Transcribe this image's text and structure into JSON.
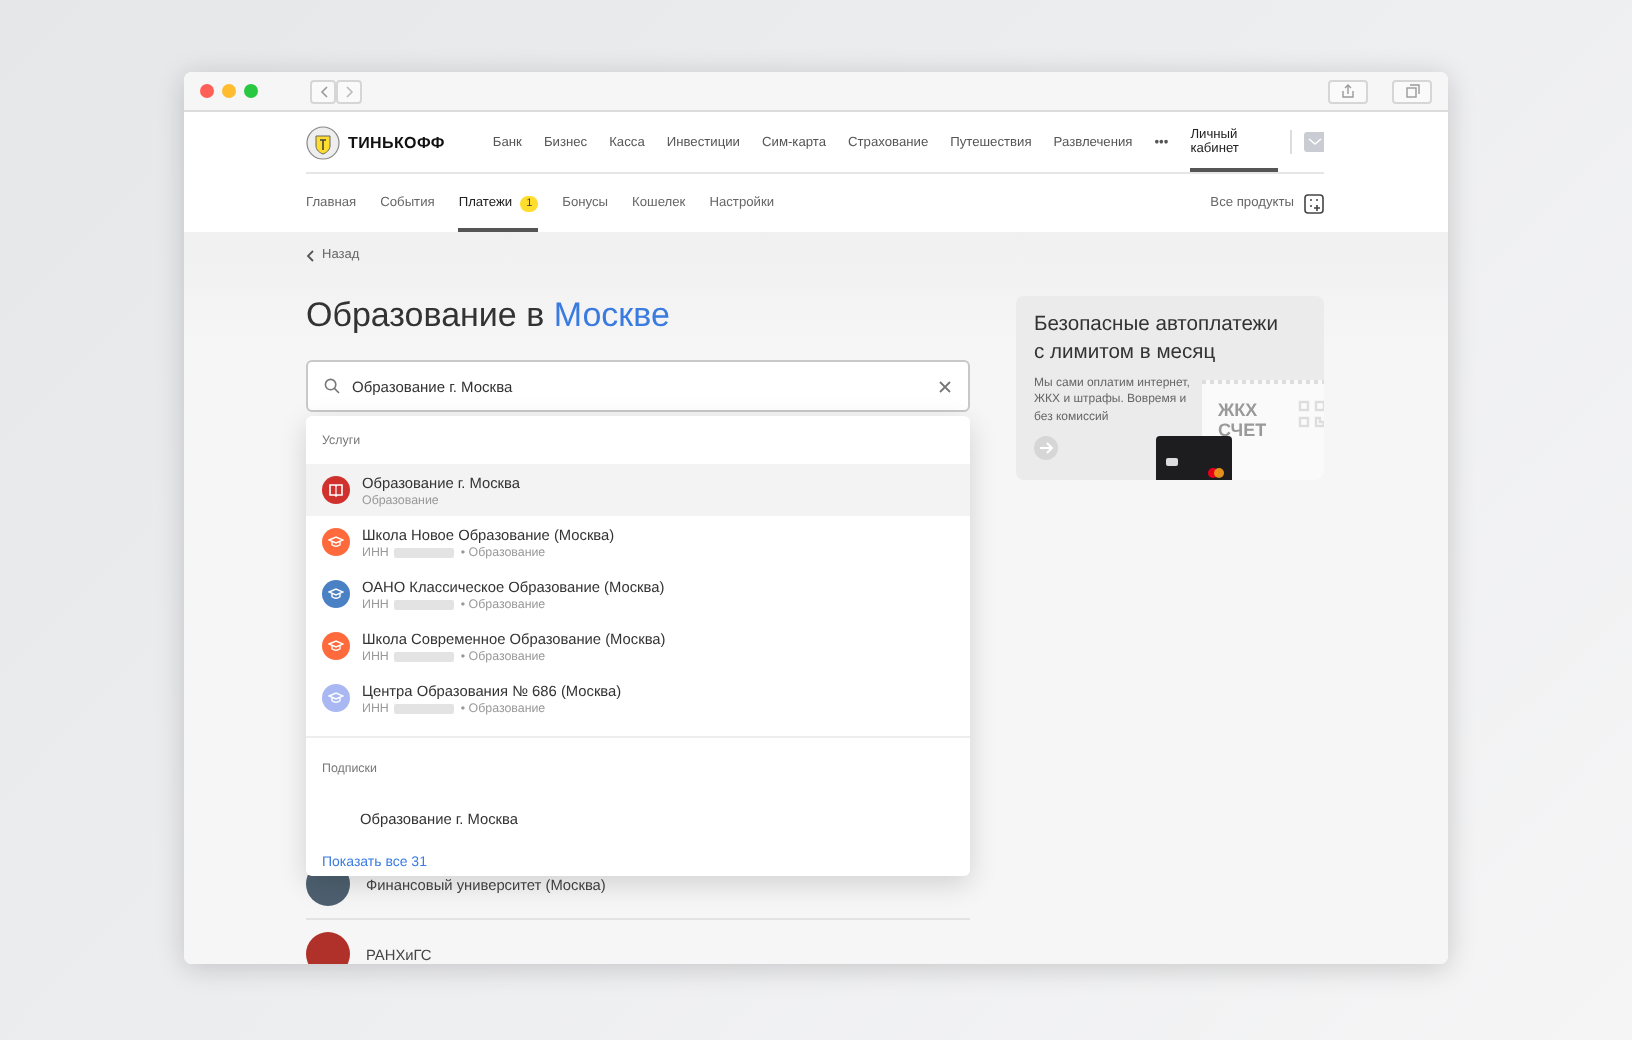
{
  "header": {
    "logo": "ТИНЬКОФФ",
    "nav": [
      "Банк",
      "Бизнес",
      "Касса",
      "Инвестиции",
      "Сим-карта",
      "Страхование",
      "Путешествия",
      "Развлечения"
    ],
    "more": "•••",
    "account": "Личный кабинет"
  },
  "subnav": {
    "tabs": [
      {
        "label": "Главная",
        "selected": false
      },
      {
        "label": "События",
        "selected": false
      },
      {
        "label": "Платежи",
        "selected": true,
        "badge": "1"
      },
      {
        "label": "Бонусы",
        "selected": false
      },
      {
        "label": "Кошелек",
        "selected": false
      },
      {
        "label": "Настройки",
        "selected": false
      }
    ],
    "all_products": "Все продукты"
  },
  "back": "Назад",
  "heading": {
    "text": "Образование в",
    "highlight": "Москве"
  },
  "search": {
    "value": "Образование г. Москва"
  },
  "dropdown": {
    "sections": [
      {
        "title": "Услуги",
        "items": [
          {
            "kind": "service",
            "title": "Образование г. Москва",
            "category": "Образование",
            "color": "#d0312d",
            "selected": true
          },
          {
            "kind": "organization",
            "title": "Школа Новое Образование (Москва)",
            "inn_label": "ИНН",
            "category": "• Образование",
            "color": "#ff6a3d",
            "selected": false
          },
          {
            "kind": "organization",
            "title": "ОАНО Классическое Образование (Москва)",
            "inn_label": "ИНН",
            "category": "• Образование",
            "color": "#4a80c4",
            "selected": false
          },
          {
            "kind": "organization",
            "title": "Школа Современное Образование (Москва)",
            "inn_label": "ИНН",
            "category": "• Образование",
            "color": "#ff6a3d",
            "selected": false
          },
          {
            "kind": "organization",
            "title": "Центра Образования № 686 (Москва)",
            "inn_label": "ИНН",
            "category": "• Образование",
            "color": "#a9b8f2",
            "selected": false
          }
        ]
      },
      {
        "title": "Подписки",
        "items": [
          {
            "kind": "subscription",
            "title": "Образование г. Москва",
            "selected": false
          }
        ]
      }
    ],
    "show_all": "Показать все 31"
  },
  "results": [
    {
      "name": "Финансовый университет (Москва)"
    },
    {
      "name": "РАНХиГС"
    }
  ],
  "promo": {
    "title": "Безопасные автоплатежи с лимитом в месяц",
    "text": "Мы сами оплатим интернет, ЖКХ и штрафы. Вовремя и без комиссий",
    "receipt_text": "ЖКХ СЧЕТ"
  }
}
